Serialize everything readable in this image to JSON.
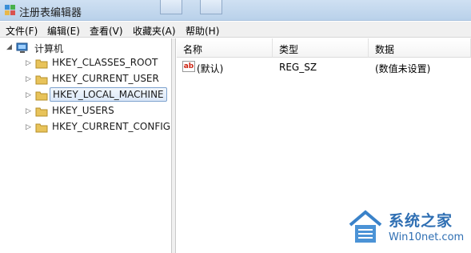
{
  "window": {
    "title": "注册表编辑器"
  },
  "menu": [
    "文件(F)",
    "编辑(E)",
    "查看(V)",
    "收藏夹(A)",
    "帮助(H)"
  ],
  "tree": {
    "root_label": "计算机",
    "keys": [
      {
        "label": "HKEY_CLASSES_ROOT",
        "selected": false
      },
      {
        "label": "HKEY_CURRENT_USER",
        "selected": false
      },
      {
        "label": "HKEY_LOCAL_MACHINE",
        "selected": true
      },
      {
        "label": "HKEY_USERS",
        "selected": false
      },
      {
        "label": "HKEY_CURRENT_CONFIG",
        "selected": false
      }
    ]
  },
  "list": {
    "columns": [
      "名称",
      "类型",
      "数据"
    ],
    "rows": [
      {
        "name": "(默认)",
        "type": "REG_SZ",
        "data": "(数值未设置)",
        "icon": "ab-string-icon"
      }
    ]
  },
  "watermark": {
    "title": "系统之家",
    "subtitle": "Win10net.com"
  },
  "colors": {
    "accent": "#2f6fb3",
    "selection_border": "#7da2ce",
    "folder": "#e8c35a"
  }
}
